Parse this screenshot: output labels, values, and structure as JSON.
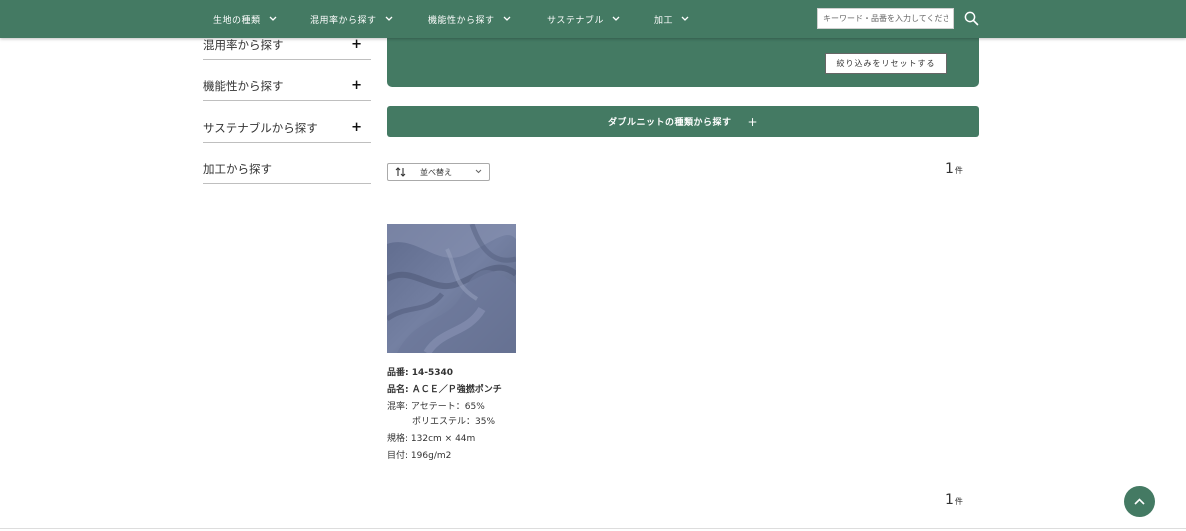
{
  "header": {
    "nav": [
      {
        "label": "生地の種類"
      },
      {
        "label": "混用率から探す"
      },
      {
        "label": "機能性から探す"
      },
      {
        "label": "サステナブル"
      },
      {
        "label": "加工"
      }
    ],
    "search": {
      "placeholder": "キーワード・品番を入力してください"
    },
    "icons": {
      "search": "search-icon",
      "chevron": "chevron-down-icon"
    }
  },
  "sidebar": {
    "items": [
      {
        "label": "混用率から探す",
        "toggle": "+"
      },
      {
        "label": "機能性から探す",
        "toggle": "+"
      },
      {
        "label": "サステナブルから探す",
        "toggle": "+"
      },
      {
        "label": "加工から探す",
        "toggle": ""
      }
    ]
  },
  "filter": {
    "reset_label": "絞り込みをリセットする",
    "double_knit_label": "ダブルニットの種類から探す",
    "double_knit_toggle": "+"
  },
  "sort": {
    "label": "並べ替え"
  },
  "results": {
    "count": "1",
    "unit": "件"
  },
  "product": {
    "number_label": "品番:",
    "number": "14-5340",
    "name_label": "品名:",
    "name": "ＡＣＥ／Ｐ強撚ポンチ",
    "blend_label": "混率:",
    "blend": [
      "アセテート：65%",
      "ポリエステル：35%"
    ],
    "spec_label": "規格:",
    "spec": "132cm × 44m",
    "weight_label": "目付:",
    "weight": "196g/m2"
  },
  "colors": {
    "brand": "#447a63",
    "fabric": "#6a7596"
  }
}
